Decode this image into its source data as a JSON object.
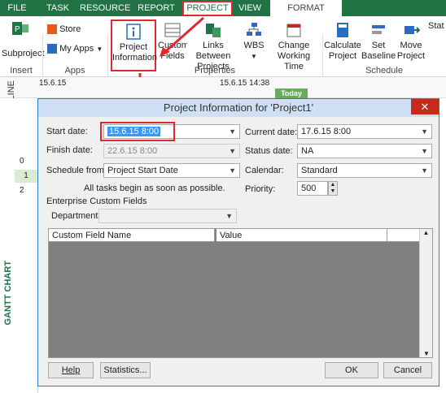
{
  "tabs": [
    "FILE",
    "TASK",
    "RESOURCE",
    "REPORT",
    "PROJECT",
    "VIEW",
    "FORMAT"
  ],
  "ribbon": {
    "subproject": "Subproject",
    "store": "Store",
    "my_apps": "My Apps",
    "project_information": "Project\nInformation",
    "custom_fields": "Custom\nFields",
    "links_between_projects": "Links Between\nProjects",
    "wbs": "WBS",
    "change_working_time": "Change\nWorking Time",
    "calculate_project": "Calculate\nProject",
    "set_baseline": "Set\nBaseline",
    "move_project": "Move\nProject",
    "status_partial": "Stat",
    "groups": {
      "insert": "Insert",
      "apps": "Apps",
      "properties": "Properties",
      "schedule": "Schedule"
    }
  },
  "timeline": {
    "label": "TIMELINE",
    "date1": "15.6.15",
    "date2": "15.6.15 14:38",
    "today": "Today"
  },
  "rows": [
    "0",
    "1",
    "2"
  ],
  "gantt_label": "GANTT CHART",
  "dialog": {
    "title": "Project Information for 'Project1'",
    "close": "✕",
    "start_date_label": "Start date:",
    "start_date": "15.6.15 8:00",
    "finish_date_label": "Finish date:",
    "finish_date": "22.6.15 8:00",
    "schedule_from_label": "Schedule from:",
    "schedule_from": "Project Start Date",
    "note": "All tasks begin as soon as possible.",
    "current_date_label": "Current date:",
    "current_date": "17.6.15 8:00",
    "status_date_label": "Status date:",
    "status_date": "NA",
    "calendar_label": "Calendar:",
    "calendar": "Standard",
    "priority_label": "Priority:",
    "priority": "500",
    "enterprise_label": "Enterprise Custom Fields",
    "department_label": "Department:",
    "department": "",
    "grid_headers": [
      "Custom Field Name",
      "Value"
    ],
    "help": "Help",
    "statistics": "Statistics...",
    "ok": "OK",
    "cancel": "Cancel"
  },
  "colors": {
    "accent": "#217346",
    "highlight": "#e0282f",
    "selection": "#3399ff"
  }
}
